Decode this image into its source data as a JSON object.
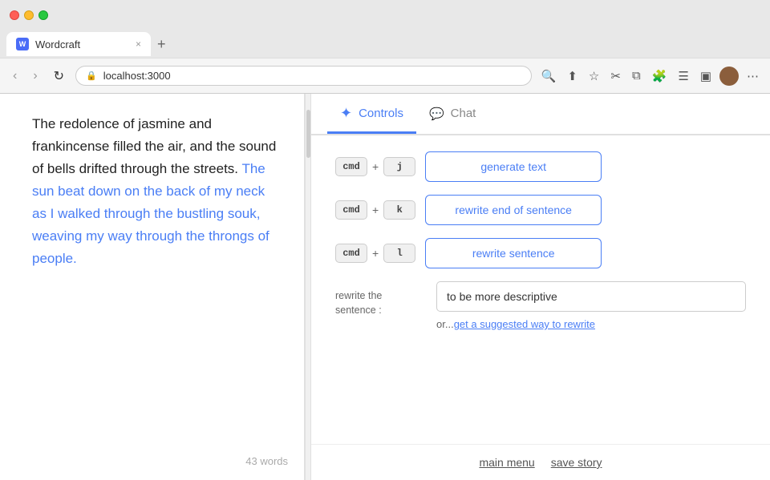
{
  "browser": {
    "tab_title": "Wordcraft",
    "tab_close": "×",
    "tab_new": "+",
    "address": "localhost:3000",
    "chevron_down": "⌄"
  },
  "editor": {
    "normal_text_1": "The redolence of jasmine and frankincense filled the air, and the sound of bells drifted through the streets.",
    "selected_text": "The sun beat down on the back of my neck as I walked through the bustling souk, weaving my way through the throngs of people.",
    "word_count": "43 words"
  },
  "controls": {
    "tab_active_label": "Controls",
    "tab_inactive_label": "Chat",
    "shortcuts": [
      {
        "mod": "cmd",
        "plus": "+",
        "key": "j",
        "action": "generate text"
      },
      {
        "mod": "cmd",
        "plus": "+",
        "key": "k",
        "action": "rewrite end of sentence"
      },
      {
        "mod": "cmd",
        "plus": "+",
        "key": "l",
        "action": "rewrite sentence"
      }
    ],
    "rewrite_label": "rewrite the sentence :",
    "rewrite_placeholder": "to be more descriptive",
    "rewrite_or_prefix": "or...",
    "rewrite_link": "get a suggested way to rewrite"
  },
  "footer": {
    "main_menu": "main menu",
    "save_story": "save story"
  }
}
